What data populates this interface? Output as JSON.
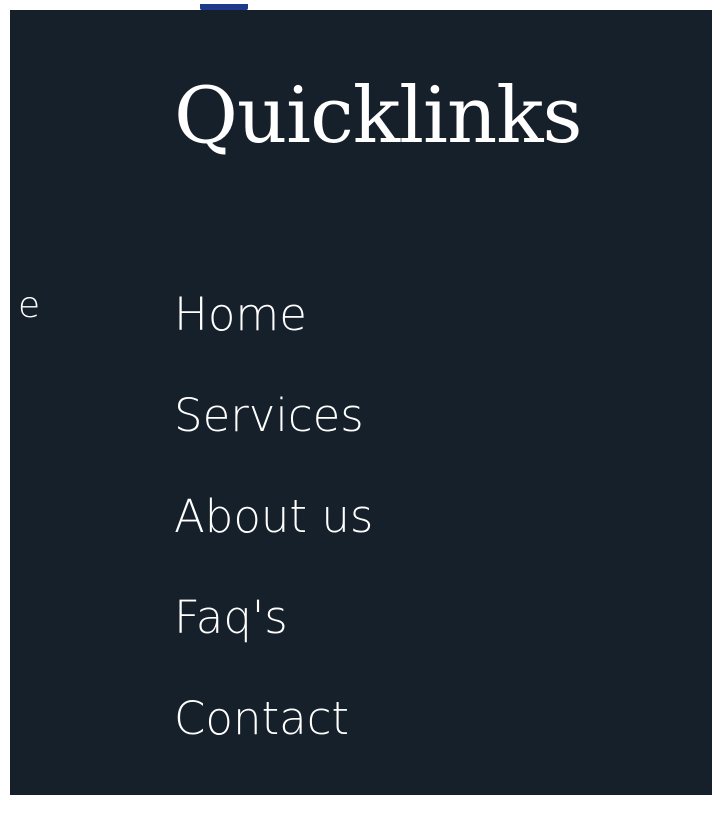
{
  "footer": {
    "clipped_text": "e",
    "quicklinks": {
      "title": "Quicklinks",
      "links": [
        {
          "label": "Home"
        },
        {
          "label": "Services"
        },
        {
          "label": "About us"
        },
        {
          "label": "Faq's"
        },
        {
          "label": "Contact"
        }
      ]
    }
  },
  "colors": {
    "panel_background": "#16202a",
    "text": "#ffffff",
    "accent": "#1f3a8a"
  }
}
